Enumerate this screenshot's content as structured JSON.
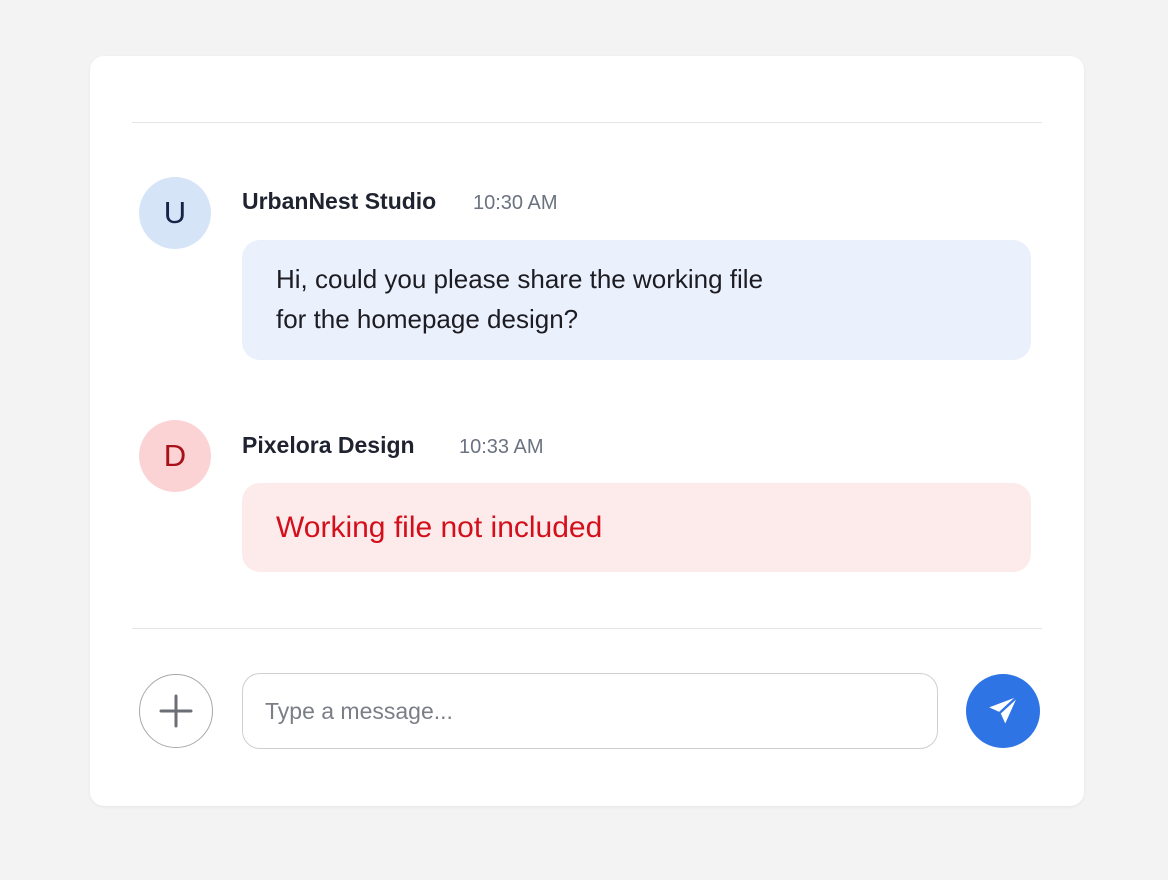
{
  "colors": {
    "page_background": "#f3f3f3",
    "card_background": "#ffffff",
    "accent": "#2f74e5",
    "incoming_bubble": "#eaf1fd",
    "error_bubble": "#fdebec",
    "error_text": "#d40f1c"
  },
  "messages": [
    {
      "avatar_initial": "U",
      "avatar_bg": "#d6e4f8",
      "avatar_color": "#152447",
      "sender": "UrbanNest Studio",
      "time": "10:30 AM",
      "text": "Hi, could you please share the working file\nfor the homepage design?",
      "bubble_bg": "#eaf1fd",
      "text_color": "#1c1c22"
    },
    {
      "avatar_initial": "D",
      "avatar_bg": "#fbd3d4",
      "avatar_color": "#a8101a",
      "sender": "Pixelora Design",
      "time": "10:33 AM",
      "text": "Working file not included",
      "bubble_bg": "#fdebec",
      "text_color": "#d40f1c"
    }
  ],
  "composer": {
    "placeholder": "Type a message...",
    "value": "",
    "add_icon": "plus-icon",
    "send_icon": "paper-plane-icon"
  }
}
